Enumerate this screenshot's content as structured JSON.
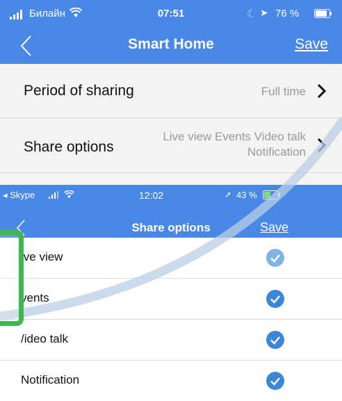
{
  "top_screen": {
    "status": {
      "carrier": "Билайн",
      "time": "07:51",
      "battery": "76 %"
    },
    "nav": {
      "title": "Smart Home",
      "save": "Save"
    },
    "rows": [
      {
        "label": "Period of sharing",
        "value_line1": "Full time",
        "value_line2": ""
      },
      {
        "label": "Share options",
        "value_line1": "Live view Events Video talk",
        "value_line2": "Notification"
      }
    ]
  },
  "bottom_screen": {
    "status": {
      "app": "◂ Skype",
      "time": "12:02",
      "battery": "43 %"
    },
    "nav": {
      "title": "Share options",
      "save": "Save"
    },
    "options": [
      {
        "label": "ive view",
        "checked": true
      },
      {
        "label": "vents",
        "checked": true
      },
      {
        "label": "/ideo talk",
        "checked": true
      },
      {
        "label": "Notification",
        "checked": true
      }
    ]
  },
  "colors": {
    "nav_blue": "#4a88e8",
    "check_blue": "#3a86d8",
    "highlight_green": "#3db84a"
  }
}
